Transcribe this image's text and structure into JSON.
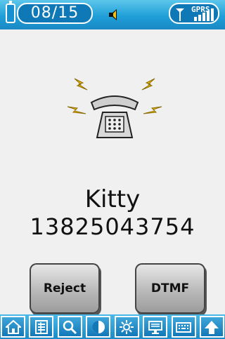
{
  "status_bar": {
    "date": "08/15",
    "gprs_label": "GPRS",
    "icons": [
      "battery-icon",
      "speaker-icon",
      "signal-icon"
    ]
  },
  "call": {
    "caller_name": "Kitty",
    "caller_number": "13825043754",
    "icon": "ringing-phone-icon"
  },
  "buttons": {
    "reject": "Reject",
    "dtmf": "DTMF"
  },
  "taskbar": {
    "icons": [
      "home-icon",
      "menu-list-icon",
      "search-icon",
      "contrast-icon",
      "brightness-icon",
      "desktop-icon",
      "keyboard-icon",
      "up-arrow-icon"
    ]
  },
  "colors": {
    "status_bar": "#1f9fd8",
    "background": "#f0f0f0",
    "lightning": "#f5c400"
  }
}
